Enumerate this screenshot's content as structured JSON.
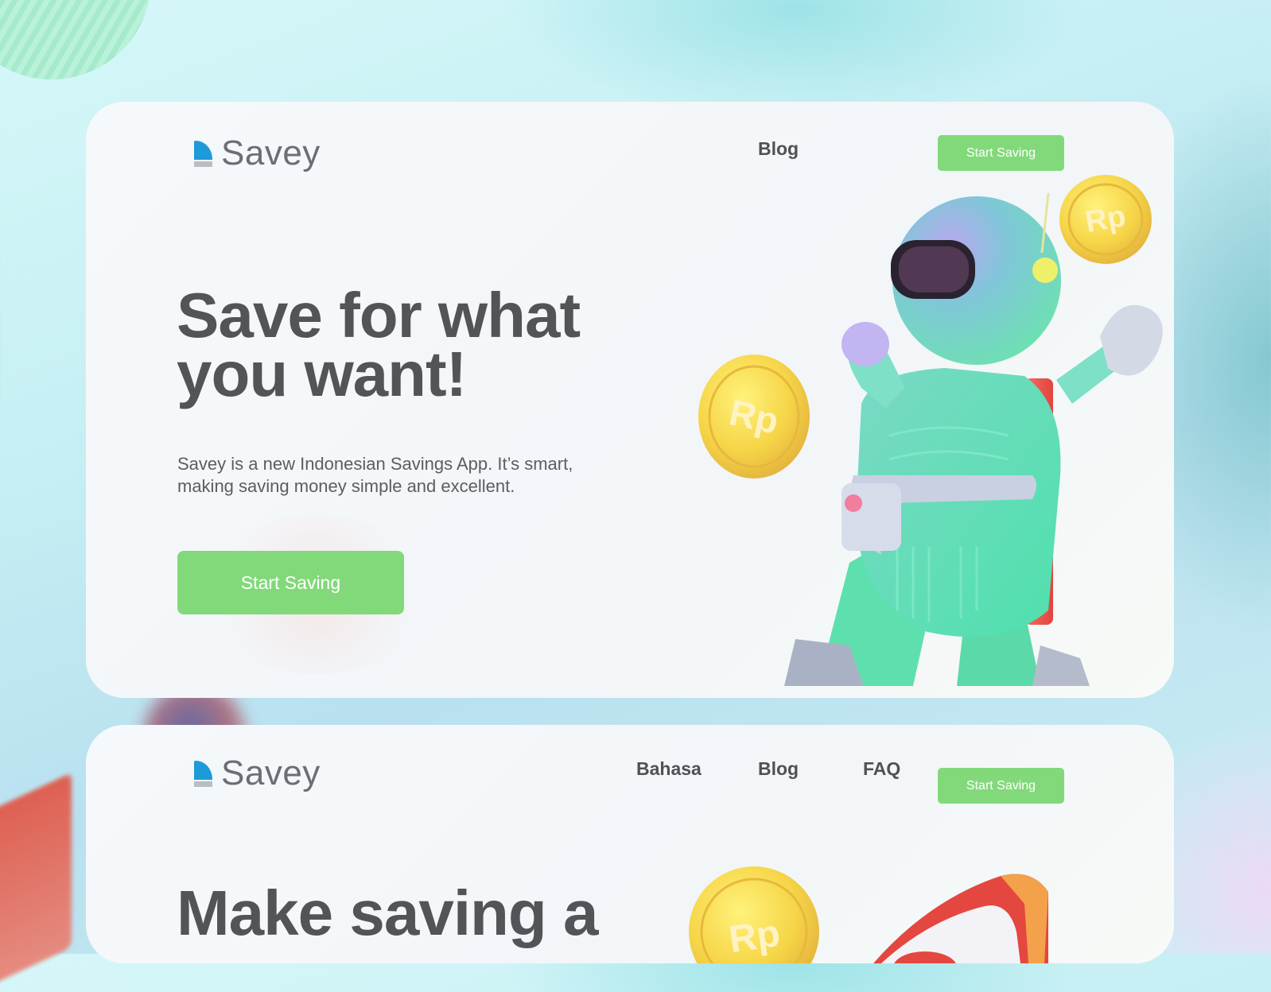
{
  "brand": {
    "name": "Savey",
    "colors": {
      "primary_blue": "#1d9ad8",
      "accent_green": "#82d97a",
      "text_dark": "#535457"
    }
  },
  "hero": {
    "nav": {
      "blog": "Blog",
      "cta": "Start Saving"
    },
    "headline_line1": "Save for what",
    "headline_line2": "you want!",
    "description_line1": "Savey is a new Indonesian Savings App. It’s smart,",
    "description_line2": "making saving money simple and excellent.",
    "cta": "Start Saving",
    "coin_label": "Rp"
  },
  "second": {
    "nav": {
      "bahasa": "Bahasa",
      "blog": "Blog",
      "faq": "FAQ",
      "cta": "Start Saving"
    },
    "headline_line1": "Make saving a",
    "coin_label": "Rp"
  },
  "icons": [
    "logo-mark-icon",
    "coin-icon",
    "astronaut-illustration",
    "rocket-illustration"
  ]
}
